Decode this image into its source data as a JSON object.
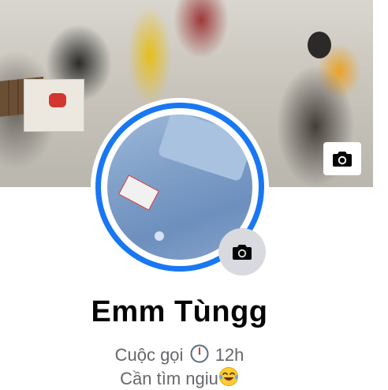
{
  "profile": {
    "name": "Emm Tùngg",
    "bio_line1_before": "Cuộc gọi",
    "bio_line1_after": "12h",
    "bio_line2": "Cần tìm ngiu"
  },
  "icons": {
    "cover_camera": "camera-icon",
    "avatar_camera": "camera-icon",
    "clock": "clock-icon",
    "laughing_emoji": "face-with-tears-of-joy-icon"
  },
  "colors": {
    "story_ring": "#1877f2",
    "name_text": "#050505",
    "bio_text": "#65676b",
    "camera_button_bg": "#d8dadf"
  }
}
